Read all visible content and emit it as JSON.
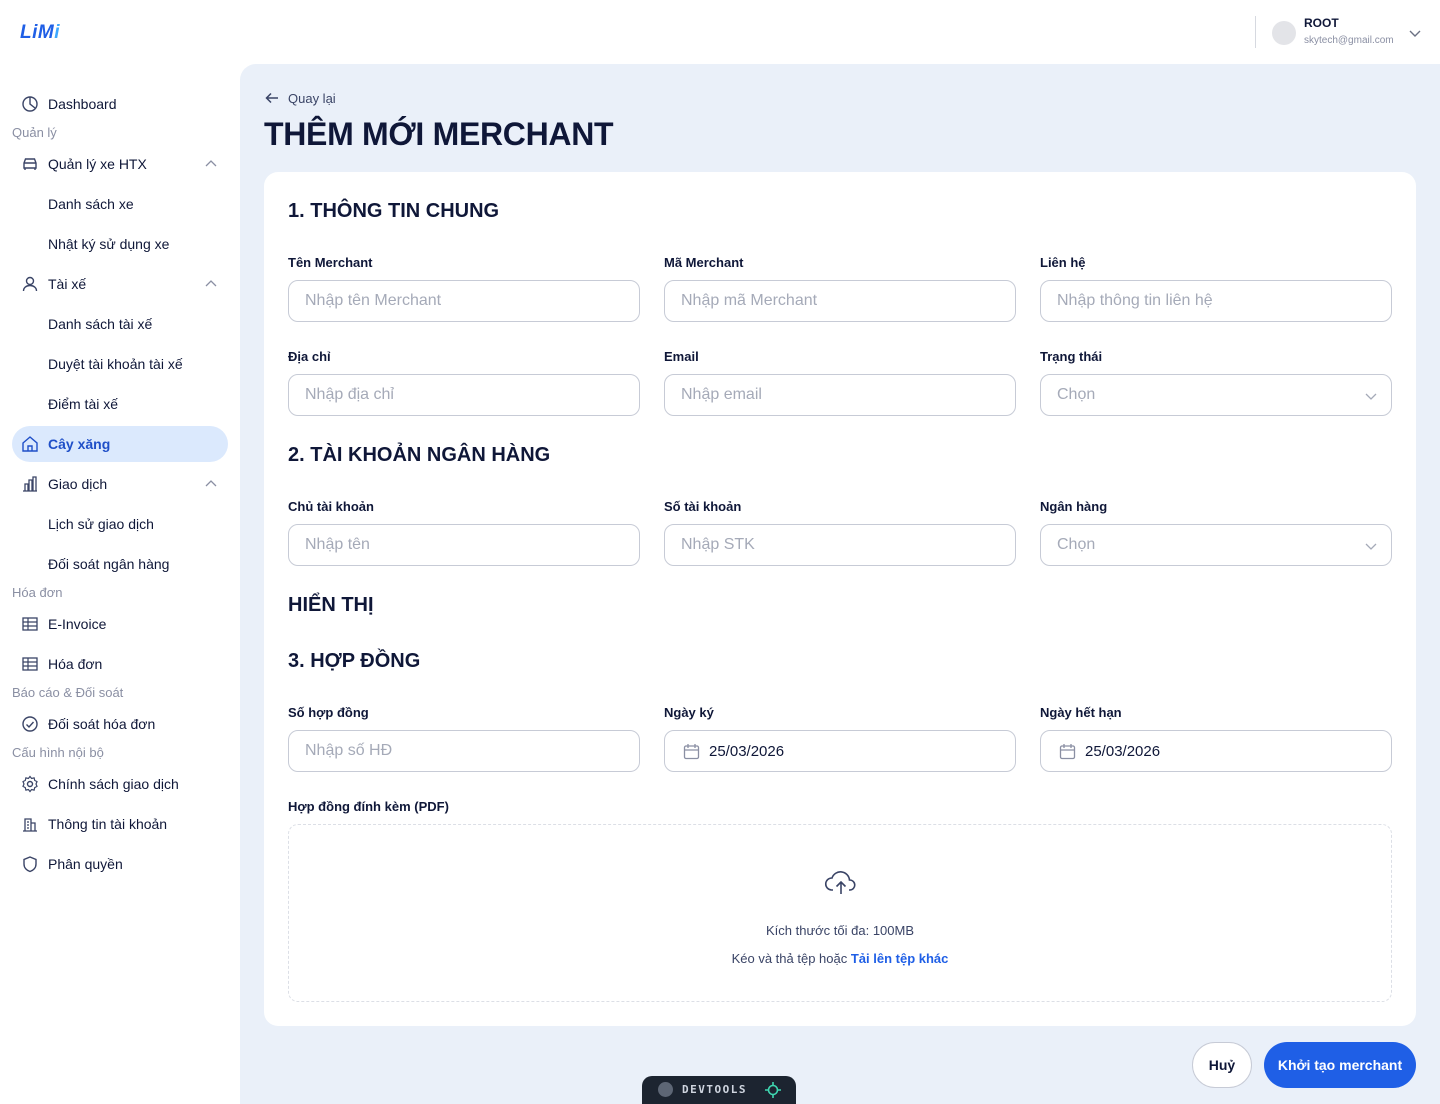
{
  "header": {
    "logo": {
      "main": "LiM",
      "accent": "i"
    },
    "user": {
      "name": "ROOT",
      "email": "skytech@gmail.com"
    }
  },
  "sidebar": {
    "dashboard": "Dashboard",
    "section_manage": "Quản lý",
    "vehicles": "Quản lý xe HTX",
    "vehicle_list": "Danh sách xe",
    "vehicle_log": "Nhật ký sử dụng xe",
    "drivers": "Tài xế",
    "driver_list": "Danh sách tài xế",
    "driver_approval": "Duyệt tài khoản tài xế",
    "driver_points": "Điểm tài xế",
    "gas_station": "Cây xăng",
    "transactions": "Giao dịch",
    "transaction_history": "Lịch sử giao dịch",
    "bank_reconcile": "Đối soát ngân hàng",
    "section_invoice": "Hóa đơn",
    "einvoice": "E-Invoice",
    "invoice": "Hóa đơn",
    "section_report": "Báo cáo & Đối soát",
    "invoice_reconcile": "Đối soát hóa đơn",
    "section_config": "Cấu hình nội bộ",
    "transaction_policy": "Chính sách giao dịch",
    "account_info": "Thông tin tài khoản",
    "permissions": "Phân quyền"
  },
  "main": {
    "back": "Quay lại",
    "title": "THÊM MỚI MERCHANT",
    "section1": "1. THÔNG TIN CHUNG",
    "name_label": "Tên Merchant",
    "name_placeholder": "Nhập tên Merchant",
    "code_label": "Mã Merchant",
    "code_placeholder": "Nhập mã Merchant",
    "contact_label": "Liên hệ",
    "contact_placeholder": "Nhập thông tin liên hệ",
    "address_label": "Địa chỉ",
    "address_placeholder": "Nhập địa chỉ",
    "email_label": "Email",
    "email_placeholder": "Nhập email",
    "status_label": "Trạng thái",
    "status_value": "Chọn",
    "section2": "2. TÀI KHOẢN NGÂN HÀNG",
    "holder_label": "Chủ tài khoản",
    "holder_placeholder": "Nhập tên",
    "account_label": "Số tài khoản",
    "account_placeholder": "Nhập STK",
    "bank_label": "Ngân hàng",
    "bank_value": "Chọn",
    "display_title": "HIỂN THỊ",
    "section3": "3. HỢP ĐỒNG",
    "contract_label": "Số hợp đồng",
    "contract_placeholder": "Nhập số HĐ",
    "sign_label": "Ngày ký",
    "sign_value": "25/03/2026",
    "expire_label": "Ngày hết hạn",
    "expire_value": "25/03/2026",
    "attach_label": "Hợp đồng đính kèm (PDF)",
    "max_size": "Kích thước tối đa: 100MB",
    "drag_text": "Kéo và thả tệp hoặc ",
    "upload_link": "Tải lên tệp khác",
    "cancel": "Huỷ",
    "create": "Khởi tạo merchant"
  },
  "devtools": {
    "label": "DEVTOOLS"
  },
  "colors": {
    "primary": "#1f5fe6",
    "active_bg": "#dbe9fd",
    "main_bg": "#eaf0f9",
    "text": "#0f1738"
  }
}
